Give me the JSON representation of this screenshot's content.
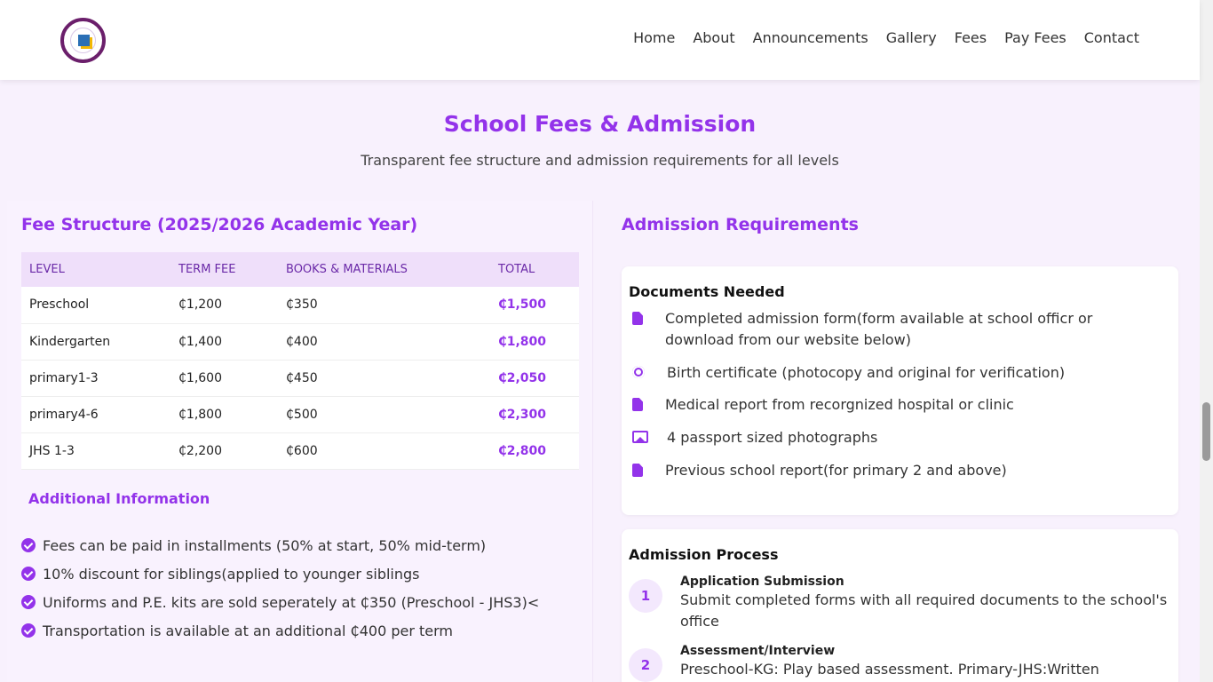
{
  "header": {
    "logo_alt": "school-logo",
    "nav": [
      "Home",
      "About",
      "Announcements",
      "Gallery",
      "Fees",
      "Pay Fees",
      "Contact"
    ]
  },
  "hero": {
    "title": "School Fees & Admission",
    "subtitle": "Transparent fee structure and admission requirements for all levels"
  },
  "fees": {
    "heading": "Fee Structure (2025/2026 Academic Year)",
    "columns": [
      "LEVEL",
      "TERM FEE",
      "BOOKS & MATERIALS",
      "TOTAL"
    ],
    "rows": [
      [
        "Preschool",
        "₵1,200",
        "₵350",
        "₵1,500"
      ],
      [
        "Kindergarten",
        "₵1,400",
        "₵400",
        "₵1,800"
      ],
      [
        "primary1-3",
        "₵1,600",
        "₵450",
        "₵2,050"
      ],
      [
        "primary4-6",
        "₵1,800",
        "₵500",
        "₵2,300"
      ],
      [
        "JHS 1-3",
        "₵2,200",
        "₵600",
        "₵2,800"
      ]
    ],
    "additional_heading": "Additional Information",
    "additional": [
      "Fees can be paid in installments (50% at start, 50% mid-term)",
      "10% discount for siblings(applied to younger siblings",
      "Uniforms and P.E. kits are sold seperately at ₵350 (Preschool - JHS3)<",
      "Transportation is available at an additional ₵400 per term"
    ]
  },
  "admission": {
    "heading": "Admission Requirements",
    "documents_title": "Documents Needed",
    "documents": [
      {
        "icon": "file-icon",
        "text": "Completed admission form(form available at school officr or download from our website below)"
      },
      {
        "icon": "certificate-icon",
        "text": "Birth certificate (photocopy and original for verification)"
      },
      {
        "icon": "medical-file-icon",
        "text": "Medical report from recorgnized hospital or clinic"
      },
      {
        "icon": "images-icon",
        "text": "4 passport sized photographs"
      },
      {
        "icon": "report-file-icon",
        "text": "Previous school report(for primary 2 and above)"
      }
    ],
    "process_title": "Admission Process",
    "steps": [
      {
        "num": "1",
        "title": "Application Submission",
        "text": "Submit completed forms with all required documents to the school's office"
      },
      {
        "num": "2",
        "title": "Assessment/Interview",
        "text": "Preschool-KG: Play based assessment. Primary-JHS:Written"
      }
    ]
  },
  "colors": {
    "accent": "#9333ea",
    "background": "#f8f1fd",
    "table_header": "#efdffa"
  }
}
